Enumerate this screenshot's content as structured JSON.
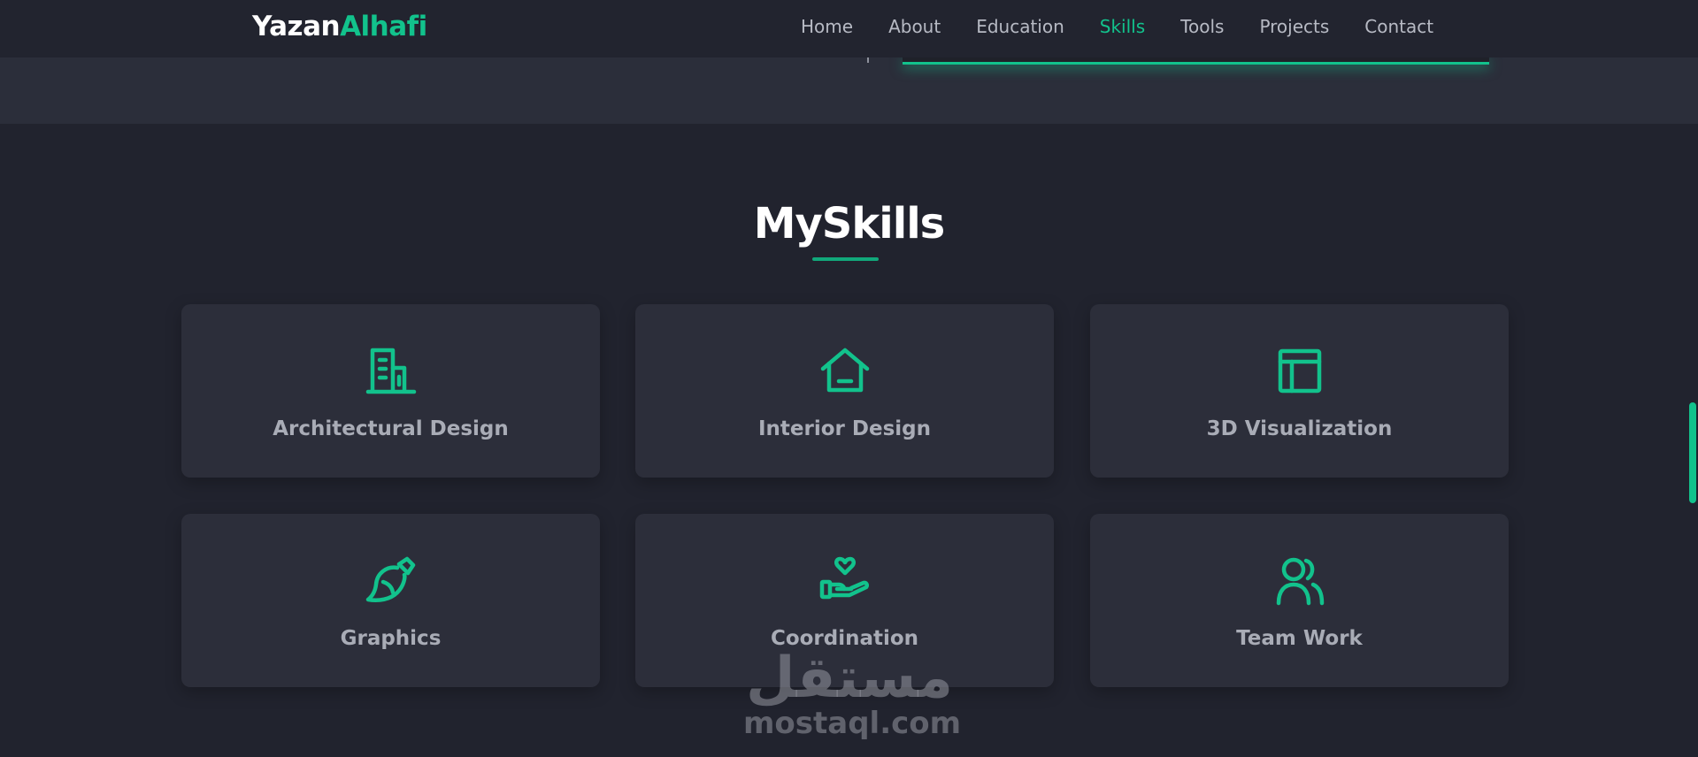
{
  "logo": {
    "first": "Yazan",
    "second": "Alhafi"
  },
  "nav": {
    "items": [
      {
        "label": "Home"
      },
      {
        "label": "About"
      },
      {
        "label": "Education"
      },
      {
        "label": "Skills"
      },
      {
        "label": "Tools"
      },
      {
        "label": "Projects"
      },
      {
        "label": "Contact"
      }
    ],
    "active": "Skills"
  },
  "skills": {
    "title": "MySkills",
    "cards": [
      {
        "label": "Architectural Design",
        "icon": "building-icon"
      },
      {
        "label": "Interior Design",
        "icon": "house-icon"
      },
      {
        "label": "3D Visualization",
        "icon": "layout-icon"
      },
      {
        "label": "Graphics",
        "icon": "paintbrush-icon"
      },
      {
        "label": "Coordination",
        "icon": "hand-heart-icon"
      },
      {
        "label": "Team Work",
        "icon": "users-icon"
      }
    ]
  },
  "watermark": {
    "arabic": "مستقل",
    "latin": "mostaql.com"
  },
  "colors": {
    "accent": "#12c28c",
    "background": "#21232e",
    "card": "#2c2e3a",
    "navbar": "#22242f"
  }
}
